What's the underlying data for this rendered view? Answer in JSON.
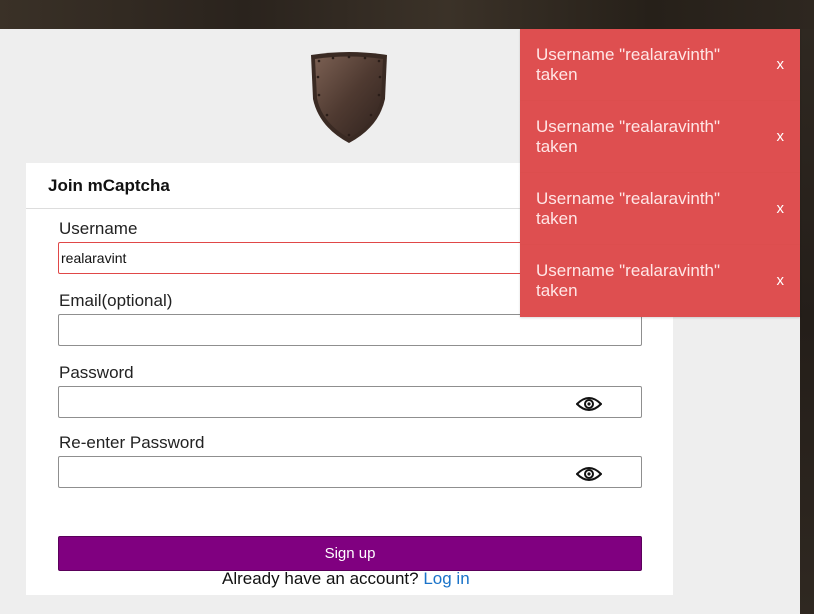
{
  "form": {
    "title": "Join mCaptcha",
    "username": {
      "label": "Username",
      "value": "realaravint"
    },
    "email": {
      "label": "Email(optional)",
      "value": ""
    },
    "password": {
      "label": "Password",
      "value": ""
    },
    "confirm_password": {
      "label": "Re-enter Password",
      "value": ""
    },
    "submit_label": "Sign up"
  },
  "footer": {
    "prompt": "Already have an account?",
    "login_link": "Log in"
  },
  "toasts": [
    {
      "message": "Username \"realaravinth\" taken",
      "close": "x"
    },
    {
      "message": "Username \"realaravinth\" taken",
      "close": "x"
    },
    {
      "message": "Username \"realaravinth\" taken",
      "close": "x"
    },
    {
      "message": "Username \"realaravinth\" taken",
      "close": "x"
    }
  ],
  "icons": {
    "logo": "shield-logo",
    "password_toggle": "eye-icon",
    "confirm_toggle": "eye-icon"
  },
  "colors": {
    "primary_button": "#800080",
    "toast_error": "#de4f50",
    "link": "#1a73c9",
    "error_border": "#e04848"
  }
}
